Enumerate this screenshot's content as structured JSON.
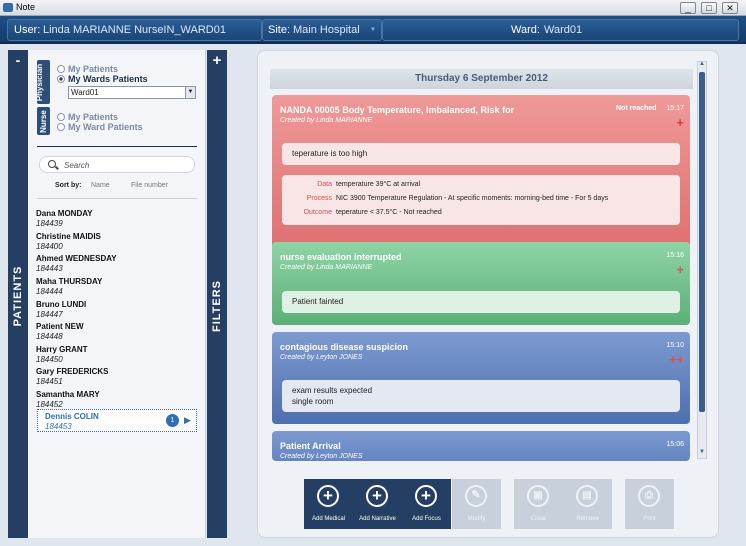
{
  "window": {
    "title": "Note",
    "minimize": "_",
    "maximize": "□",
    "close": "✕"
  },
  "header": {
    "user_label": "User:",
    "user_value": "Linda MARIANNE   NurseIN_WARD01",
    "site_label": "Site:",
    "site_value": "Main Hospital",
    "ward_label": "Ward:",
    "ward_value": "Ward01"
  },
  "left_sidebar": {
    "collapse_label": "-",
    "vertical_label": "PATIENTS"
  },
  "patients_panel": {
    "physician_tab": "Physician",
    "nurse_tab": "Nurse",
    "physician_options": [
      "My Patients",
      "My Wards Patients"
    ],
    "selected_ward": "Ward01",
    "nurse_options": [
      "My Patients",
      "My Ward Patients"
    ],
    "search_placeholder": "Search",
    "sort_label": "Sort by:",
    "sort_name": "Name",
    "sort_file": "File number",
    "patients": [
      {
        "name": "Dana MONDAY",
        "id": "184439"
      },
      {
        "name": "Christine MAIDIS",
        "id": "184400"
      },
      {
        "name": "Ahmed WEDNESDAY",
        "id": "184443"
      },
      {
        "name": "Maha THURSDAY",
        "id": "184444"
      },
      {
        "name": "Bruno LUNDI",
        "id": "184447"
      },
      {
        "name": "Patient NEW",
        "id": "184448"
      },
      {
        "name": "Harry GRANT",
        "id": "184450"
      },
      {
        "name": "Gary FREDERICKS",
        "id": "184451"
      },
      {
        "name": "Samantha MARY",
        "id": "184452"
      },
      {
        "name": "Dennis COLIN",
        "id": "184453",
        "badge": "1"
      }
    ]
  },
  "filters_sidebar": {
    "expand_label": "+",
    "vertical_label": "FILTERS"
  },
  "timeline": {
    "date": "Thursday 6 September 2012",
    "cards": [
      {
        "title": "NANDA 00005 Body Temperature, Imbalanced, Risk for",
        "created_by": "Created by Linda MARIANNE",
        "status": "Not reached",
        "time": "15:17",
        "plus": "+",
        "note": "teperature is too high",
        "details": {
          "data_label": "Data",
          "data_value": "temperature 39°C at arrival",
          "process_label": "Process",
          "process_value": "NIC 3900 Temperature Regulation - At specific moments: morning-bed time - For 5 days",
          "outcome_label": "Outcome",
          "outcome_value": "teperature < 37.5°C - Not reached"
        }
      },
      {
        "title": "nurse evaluation interrupted",
        "created_by": "Created by Linda MARIANNE",
        "time": "15:16",
        "plus": "+",
        "note": "Patient fainted"
      },
      {
        "title": "contagious disease suspicion",
        "created_by": "Created by Leyton JONES",
        "time": "15:10",
        "plus": "++",
        "note_lines": [
          "exam results expected",
          "single room"
        ]
      },
      {
        "title": "Patient Arrival",
        "created_by": "Created by Leyton JONES",
        "time": "15:06"
      }
    ]
  },
  "toolbar": {
    "add_medical": "Add Medical",
    "add_narrative": "Add Narrative",
    "add_focus": "Add Focus",
    "modify": "Modify",
    "close": "Close",
    "remove": "Remove",
    "print": "Print"
  },
  "colors": {
    "red_card": "#e37a7a",
    "green_card": "#6cbd86",
    "blue_card": "#5b7fbe",
    "navy": "#243f63"
  }
}
